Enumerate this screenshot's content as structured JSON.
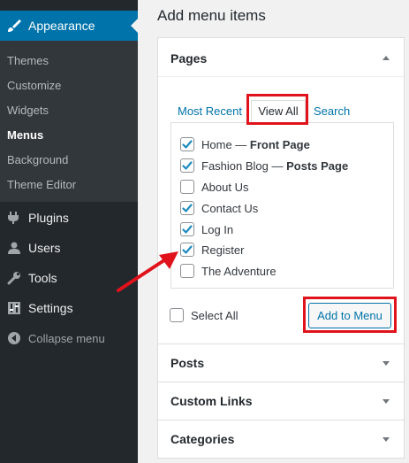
{
  "sidebar": {
    "appearance_label": "Appearance",
    "submenu": [
      "Themes",
      "Customize",
      "Widgets",
      "Menus",
      "Background",
      "Theme Editor"
    ],
    "current_submenu": "Menus",
    "menu": [
      {
        "label": "Plugins",
        "icon": "plugin-icon"
      },
      {
        "label": "Users",
        "icon": "user-icon"
      },
      {
        "label": "Tools",
        "icon": "wrench-icon"
      },
      {
        "label": "Settings",
        "icon": "settings-sliders-icon"
      }
    ],
    "collapse_label": "Collapse menu"
  },
  "main": {
    "title": "Add menu items",
    "pages": {
      "title": "Pages",
      "tabs": [
        "Most Recent",
        "View All",
        "Search"
      ],
      "active_tab": "View All",
      "items": [
        {
          "label": "Home",
          "suffix": "Front Page",
          "checked": true
        },
        {
          "label": "Fashion Blog",
          "suffix": "Posts Page",
          "checked": true
        },
        {
          "label": "About Us",
          "suffix": "",
          "checked": false
        },
        {
          "label": "Contact Us",
          "suffix": "",
          "checked": true
        },
        {
          "label": "Log In",
          "suffix": "",
          "checked": true
        },
        {
          "label": "Register",
          "suffix": "",
          "checked": true
        },
        {
          "label": "The Adventure",
          "suffix": "",
          "checked": false
        }
      ],
      "dash": " — ",
      "select_all_label": "Select All",
      "select_all_checked": false,
      "add_button_label": "Add to Menu"
    },
    "sections": [
      "Posts",
      "Custom Links",
      "Categories"
    ]
  },
  "colors": {
    "sidebar_bg": "#23282d",
    "submenu_bg": "#32373c",
    "accent_blue": "#0073aa",
    "highlight_red": "#e0121c"
  }
}
